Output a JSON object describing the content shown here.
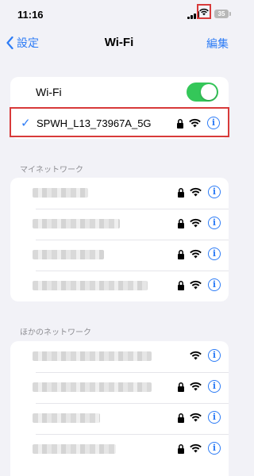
{
  "status_bar": {
    "time": "11:16",
    "battery": "35"
  },
  "nav": {
    "back_label": "設定",
    "title": "Wi-Fi",
    "edit_label": "編集"
  },
  "wifi_toggle": {
    "label": "Wi-Fi",
    "on": true
  },
  "connected_network": {
    "ssid": "SPWH_L13_73967A_5G",
    "secured": true
  },
  "sections": {
    "my_networks": "マイネットワーク",
    "other_networks": "ほかのネットワーク"
  },
  "icons": {
    "back": "chevron-left-icon",
    "check": "checkmark-icon",
    "lock": "lock-icon",
    "wifi": "wifi-icon",
    "info": "info-icon"
  },
  "colors": {
    "accent": "#2d7cf6",
    "toggle_on": "#34c759",
    "highlight": "#d83a3a"
  }
}
